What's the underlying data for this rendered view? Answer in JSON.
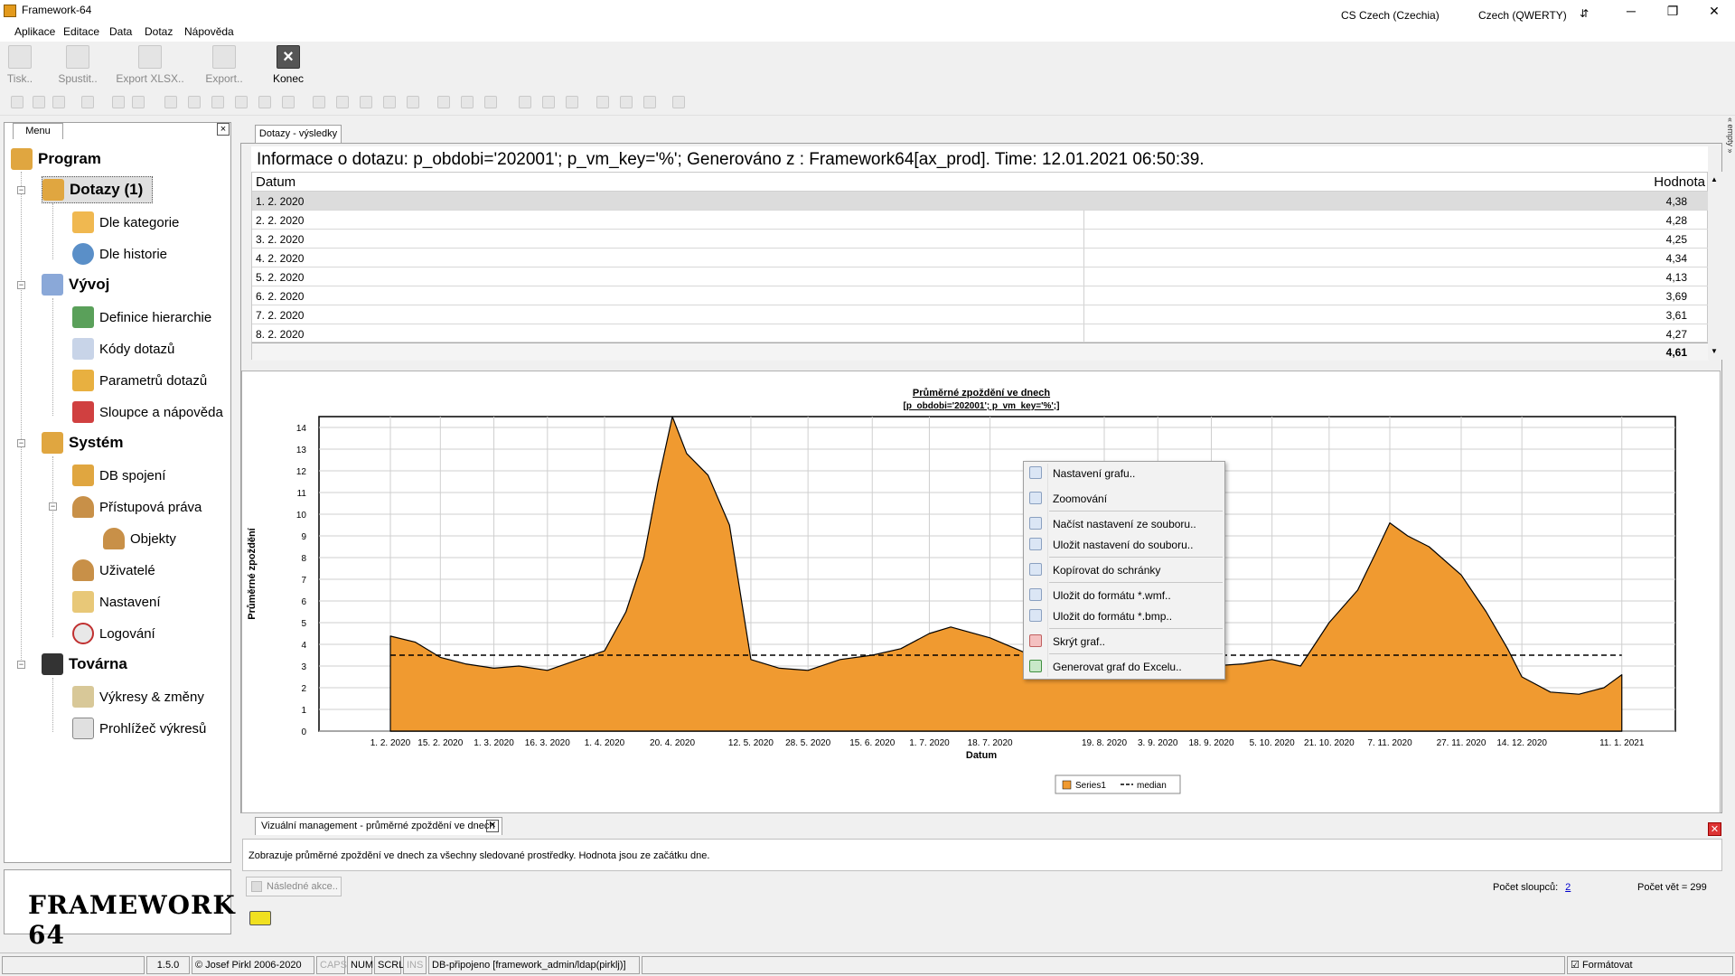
{
  "window": {
    "title": "Framework-64",
    "locale": "CS Czech (Czechia)",
    "keyboard": "Czech (QWERTY)"
  },
  "menubar": [
    "Aplikace",
    "Editace",
    "Data",
    "Dotaz",
    "Nápověda"
  ],
  "toolbar": {
    "print_label": "Tisk..",
    "run_label": "Spustit..",
    "export_xlsx_label": "Export XLSX..",
    "export_label": "Export..",
    "quit_label": "Konec"
  },
  "left_panel": {
    "tab_label": "Menu",
    "close_glyph": "×",
    "tree": [
      {
        "label": "Program",
        "bold": true
      },
      {
        "label": "Dotazy (1)",
        "bold": true
      },
      {
        "label": "Dle kategorie",
        "bold": false
      },
      {
        "label": "Dle historie",
        "bold": false
      },
      {
        "label": "Vývoj",
        "bold": true
      },
      {
        "label": "Definice hierarchie",
        "bold": false
      },
      {
        "label": "Kódy dotazů",
        "bold": false
      },
      {
        "label": "Parametrů dotazů",
        "bold": false
      },
      {
        "label": "Sloupce a nápověda",
        "bold": false
      },
      {
        "label": "Systém",
        "bold": true
      },
      {
        "label": "DB spojení",
        "bold": false
      },
      {
        "label": "Přístupová práva",
        "bold": false
      },
      {
        "label": "Objekty",
        "bold": false
      },
      {
        "label": "Uživatelé",
        "bold": false
      },
      {
        "label": "Nastavení",
        "bold": false
      },
      {
        "label": "Logování",
        "bold": false
      },
      {
        "label": "Továrna",
        "bold": true
      },
      {
        "label": "Výkresy & změny",
        "bold": false
      },
      {
        "label": "Prohlížeč výkresů",
        "bold": false
      }
    ],
    "logo_text": "FRAMEWORK 64"
  },
  "main": {
    "tab_label": "Dotazy - výsledky",
    "info_line": "Informace o dotazu: p_obdobi='202001'; p_vm_key='%'; Generováno z : Framework64[ax_prod]. Time: 12.01.2021 06:50:39.",
    "grid": {
      "headers": [
        "Datum",
        "Hodnota"
      ],
      "rows": [
        [
          "1. 2. 2020",
          "4,38"
        ],
        [
          "2. 2. 2020",
          "4,28"
        ],
        [
          "3. 2. 2020",
          "4,25"
        ],
        [
          "4. 2. 2020",
          "4,34"
        ],
        [
          "5. 2. 2020",
          "4,13"
        ],
        [
          "6. 2. 2020",
          "3,69"
        ],
        [
          "7. 2. 2020",
          "3,61"
        ],
        [
          "8. 2. 2020",
          "4,27"
        ]
      ],
      "summary": "4,61"
    }
  },
  "chart_data": {
    "type": "area",
    "title": "Průměrné zpoždění ve dnech",
    "subtitle": "[p_obdobi='202001'; p_vm_key='%';]",
    "xlabel": "Datum",
    "ylabel": "Průměrné zpoždění",
    "ylim": [
      0,
      14.5
    ],
    "yticks": [
      0,
      1,
      2,
      3,
      4,
      5,
      6,
      7,
      8,
      9,
      10,
      11,
      12,
      13,
      14
    ],
    "xticks": [
      "1. 2. 2020",
      "15. 2. 2020",
      "1. 3. 2020",
      "16. 3. 2020",
      "1. 4. 2020",
      "20. 4. 2020",
      "12. 5. 2020",
      "28. 5. 2020",
      "15. 6. 2020",
      "1. 7. 2020",
      "18. 7. 2020",
      "19. 8. 2020",
      "3. 9. 2020",
      "18. 9. 2020",
      "5. 10. 2020",
      "21. 10. 2020",
      "7. 11. 2020",
      "27. 11. 2020",
      "14. 12. 2020",
      "11. 1. 2021"
    ],
    "grid": true,
    "legend": "bottom-center",
    "series": [
      {
        "name": "Series1",
        "color": "#f09a30",
        "x": [
          "2020-02-01",
          "2020-02-08",
          "2020-02-15",
          "2020-02-22",
          "2020-03-01",
          "2020-03-08",
          "2020-03-16",
          "2020-03-23",
          "2020-04-01",
          "2020-04-07",
          "2020-04-12",
          "2020-04-16",
          "2020-04-20",
          "2020-04-24",
          "2020-04-30",
          "2020-05-06",
          "2020-05-12",
          "2020-05-20",
          "2020-05-28",
          "2020-06-06",
          "2020-06-15",
          "2020-06-23",
          "2020-07-01",
          "2020-07-07",
          "2020-07-18",
          "2020-07-28",
          "2020-08-08",
          "2020-08-19",
          "2020-08-27",
          "2020-09-03",
          "2020-09-10",
          "2020-09-18",
          "2020-09-27",
          "2020-10-05",
          "2020-10-13",
          "2020-10-21",
          "2020-10-29",
          "2020-11-03",
          "2020-11-07",
          "2020-11-12",
          "2020-11-18",
          "2020-11-27",
          "2020-12-04",
          "2020-12-10",
          "2020-12-14",
          "2020-12-22",
          "2020-12-30",
          "2021-01-06",
          "2021-01-11"
        ],
        "y": [
          4.38,
          4.1,
          3.4,
          3.1,
          2.9,
          3.0,
          2.8,
          3.2,
          3.7,
          5.5,
          8.0,
          11.5,
          14.5,
          12.8,
          11.8,
          9.5,
          3.3,
          2.9,
          2.8,
          3.3,
          3.5,
          3.8,
          4.5,
          4.8,
          4.3,
          3.6,
          3.1,
          3.0,
          3.1,
          3.4,
          3.2,
          3.0,
          3.1,
          3.3,
          3.0,
          5.0,
          6.5,
          8.2,
          9.6,
          9.0,
          8.5,
          7.2,
          5.5,
          3.8,
          2.5,
          1.8,
          1.7,
          2.0,
          2.6
        ]
      },
      {
        "name": "median",
        "color": "#000000",
        "style": "dashed",
        "x": [
          "2020-02-01",
          "2021-01-11"
        ],
        "y": [
          3.5,
          3.5
        ]
      }
    ]
  },
  "context_menu": {
    "items": [
      {
        "label": "Nastavení grafu.."
      },
      {
        "label": "Zoomování"
      },
      {
        "label": "Načíst nastavení ze souboru.."
      },
      {
        "label": "Uložit nastavení do souboru.."
      },
      {
        "label": "Kopírovat do schránky"
      },
      {
        "label": "Uložit do formátu *.wmf.."
      },
      {
        "label": "Uložit do formátu *.bmp.."
      },
      {
        "label": "Skrýt graf.."
      },
      {
        "label": "Generovat graf do Excelu.."
      }
    ]
  },
  "bottom": {
    "tab_label": "Vizuální management - průměrné zpoždění ve dnech",
    "description": "Zobrazuje průměrné zpoždění ve dnech za všechny sledované prostředky. Hodnota jsou ze začátku dne.",
    "action_button": "Následné akce..",
    "col_count_label": "Počet sloupců:",
    "col_count_value": "2",
    "row_count_label": "Počet vět = 299"
  },
  "statusbar": {
    "version": "1.5.0",
    "copyright": "© Josef Pirkl 2006-2020",
    "caps": "CAPS",
    "num": "NUM",
    "scrl": "SCRL",
    "ins": "INS",
    "db": "DB-připojeno [framework_admin/ldap(pirklj)]",
    "format_label": "Formátovat"
  },
  "right_strip": "« empty »"
}
